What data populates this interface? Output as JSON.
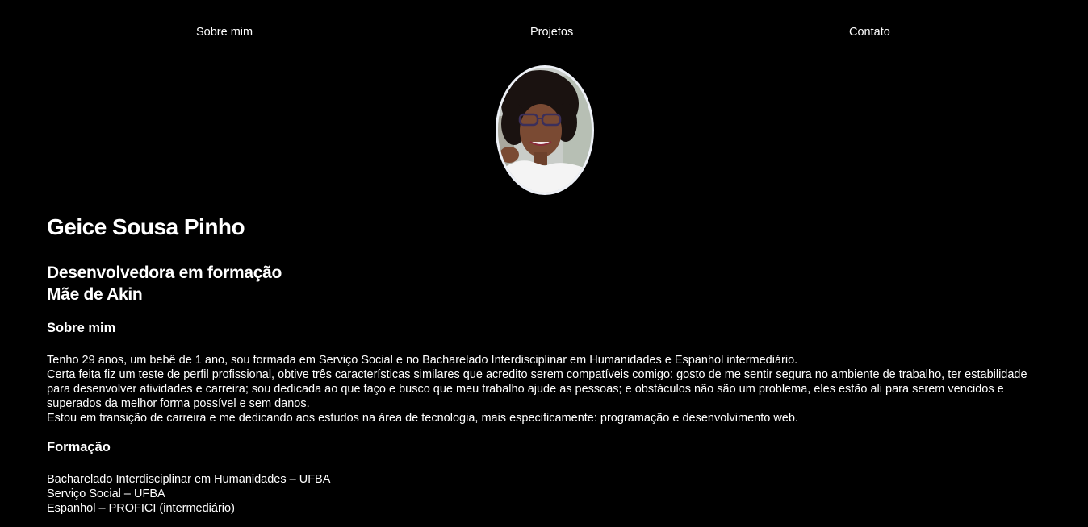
{
  "nav": {
    "items": [
      {
        "label": "Sobre mim"
      },
      {
        "label": "Projetos"
      },
      {
        "label": "Contato"
      }
    ]
  },
  "profile": {
    "name": "Geice Sousa Pinho",
    "roles": [
      "Desenvolvedora em formação",
      "Mãe de Akin"
    ]
  },
  "about": {
    "heading": "Sobre mim",
    "paragraphs": [
      "Tenho 29 anos, um bebê de 1 ano, sou formada em Serviço Social e no Bacharelado Interdisciplinar em Humanidades e Espanhol intermediário.",
      "Certa feita fiz um teste de perfil profissional, obtive três características similares que acredito serem compatíveis comigo: gosto de me sentir segura no ambiente de trabalho, ter estabilidade para desenvolver atividades e carreira; sou dedicada ao que faço e busco que meu trabalho ajude as pessoas; e obstáculos não são um problema, eles estão ali para serem vencidos e superados da melhor forma possível e sem danos.",
      "Estou em transição de carreira e me dedicando aos estudos na área de tecnologia, mais especificamente: programação e desenvolvimento web."
    ]
  },
  "education": {
    "heading": "Formação",
    "items": [
      "Bacharelado Interdisciplinar em Humanidades – UFBA",
      "Serviço Social – UFBA",
      "Espanhol – PROFICI (intermediário)"
    ]
  },
  "colors": {
    "background": "#000000",
    "text": "#ffffff",
    "avatar_border": "#eef1f7"
  }
}
